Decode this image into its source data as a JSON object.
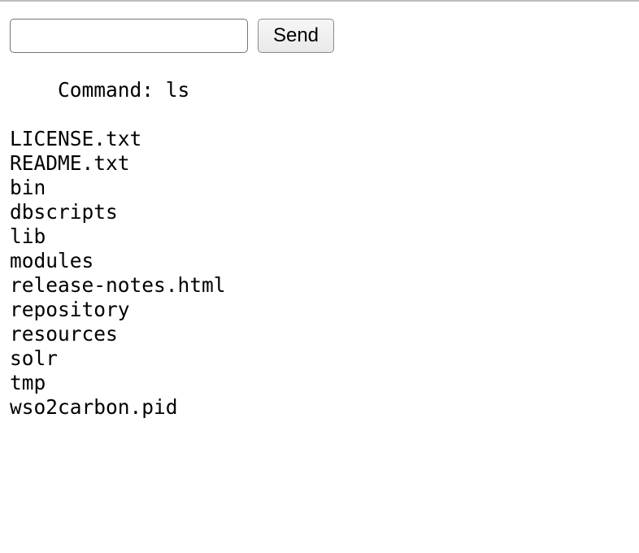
{
  "form": {
    "input_value": "",
    "input_placeholder": "",
    "send_label": "Send"
  },
  "output": {
    "command_prefix": "    Command: ",
    "command": "ls",
    "files": [
      "LICENSE.txt",
      "README.txt",
      "bin",
      "dbscripts",
      "lib",
      "modules",
      "release-notes.html",
      "repository",
      "resources",
      "solr",
      "tmp",
      "wso2carbon.pid"
    ]
  }
}
